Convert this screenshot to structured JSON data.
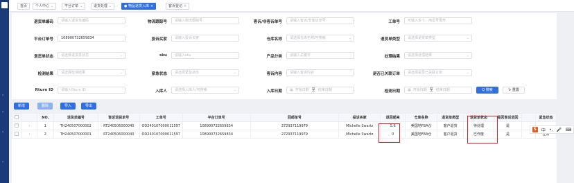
{
  "tabs": [
    {
      "label": "首页",
      "closable": false
    },
    {
      "label": "个人中心",
      "closable": false,
      "dropdown": true
    },
    {
      "label": "平台订单",
      "closable": false,
      "dropdown": true
    },
    {
      "label": "退货处理",
      "closable": false,
      "dropdown": true
    },
    {
      "label": "● 物品退货入库",
      "closable": true,
      "active": true
    },
    {
      "label": "客诉登记",
      "closable": true
    }
  ],
  "filters": {
    "return_no": {
      "label": "退货单编码",
      "placeholder": "请输入退货单编码"
    },
    "logistics_no": {
      "label": "物流跟踪号",
      "placeholder": "请输入物流跟踪号"
    },
    "complaint_no": {
      "label": "客诉/非客诉单号",
      "placeholder": "请输入客诉/非客诉单号"
    },
    "work_no": {
      "label": "工单号",
      "placeholder": "可输入多个，用逗号隔开"
    },
    "platform_order": {
      "label": "平台订单号",
      "value": "108900732659834"
    },
    "buyer": {
      "label": "投诉买家",
      "placeholder": "请输入投诉买家"
    },
    "warehouse": {
      "label": "仓库名称",
      "placeholder": "请选择仓库名称/可搜索"
    },
    "return_type": {
      "label": "退货单类型",
      "placeholder": "请选择退货单类型"
    },
    "return_status": {
      "label": "退货单状态",
      "placeholder": "请选择退货单状态"
    },
    "sku": {
      "label": "sku",
      "placeholder": "请输入sku"
    },
    "product_cat": {
      "label": "产品分类",
      "placeholder": "请输入关键字"
    },
    "handle_result": {
      "label": "处理结果",
      "placeholder": "请选择处理结果"
    },
    "check_result": {
      "label": "检测结果",
      "placeholder": "请选择检测结果"
    },
    "urgency": {
      "label": "紧急状态",
      "placeholder": "请选择紧急状态"
    },
    "complaint_content": {
      "label": "客诉内容",
      "placeholder": "请输入客诉内容"
    },
    "linked_work": {
      "label": "是否已关联订单",
      "placeholder": "请选择是否已关联订单"
    },
    "rturn_id": {
      "label": "Rturn ID",
      "placeholder": "请输入Rturn ID"
    },
    "storer": {
      "label": "入库人",
      "placeholder": "请选择入库人/可搜索"
    },
    "in_date": {
      "label": "入库日期",
      "start": "开始日期",
      "to": "至",
      "end": "结束日期"
    },
    "check_date": {
      "label": "检测日期",
      "start": "开始日期",
      "to": "至",
      "end": "结束日期"
    },
    "search_btn": "Q 搜索",
    "reset_btn": "↻ 重置"
  },
  "toolbar": {
    "add": "新增",
    "delete": "删除",
    "import": "导入",
    "export": "导出"
  },
  "table": {
    "headers": [
      "",
      "",
      "NO.",
      "退货单编号",
      "客诉退货单号",
      "工单号",
      "平台订单号",
      "回邮单号",
      "投诉买家",
      "退回邮来",
      "仓库名称",
      "退货单类型",
      "退货单状态",
      "是否客诉退回",
      "",
      "紧急状态"
    ],
    "rows": [
      [
        "",
        "",
        "1",
        "TH240507000002",
        "RT240506000040",
        "OD240107000011597",
        "108900732659834",
        "272937119979",
        "Michelle Swartz",
        "5.6",
        "美国地FBA仓",
        "客户退货",
        "待处理",
        "是",
        "",
        ""
      ],
      [
        "",
        "",
        "2",
        "TH240507000001",
        "RT240506000040",
        "OD240107000011597",
        "108900732659834",
        "272937119979",
        "Michelle Swartz",
        "0",
        "美国地FBA仓",
        "客户退货",
        "已作废",
        "是",
        "",
        "正常"
      ]
    ]
  },
  "ime": {
    "logo": "S",
    "items": [
      "中",
      "•,",
      "🎤",
      "⌨"
    ]
  }
}
